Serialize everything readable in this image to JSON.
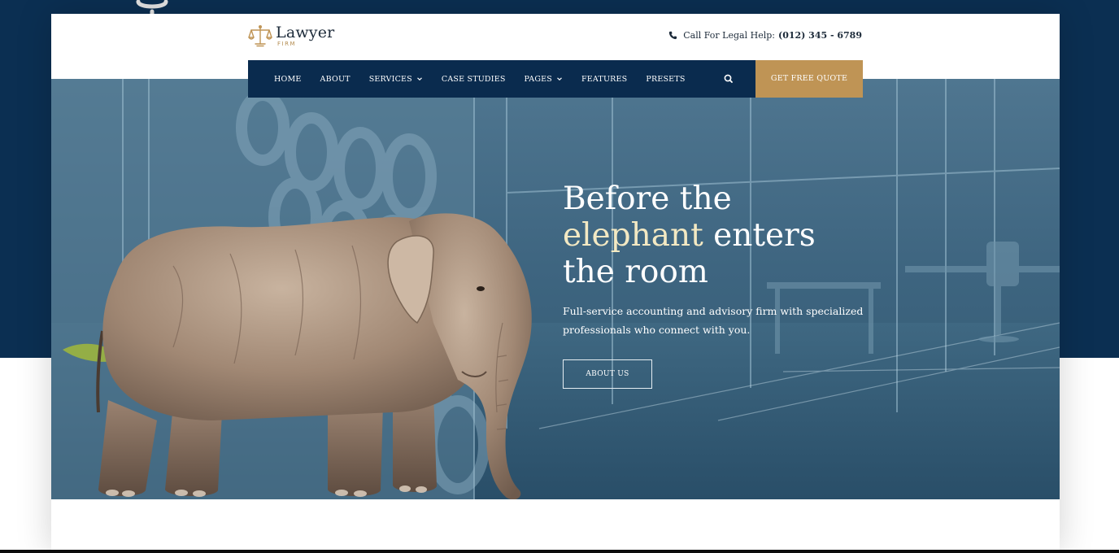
{
  "brand": {
    "name": "Lawyer",
    "tagline": "FIRM",
    "logo_icon": "scales-of-justice-icon",
    "accent_color": "#bf9455",
    "navy_color": "#0a2b4e"
  },
  "contact": {
    "icon": "phone-icon",
    "label": "Call For Legal Help:",
    "number": "(012) 345 - 6789"
  },
  "nav": {
    "items": [
      {
        "label": "HOME",
        "has_dropdown": false
      },
      {
        "label": "ABOUT",
        "has_dropdown": false
      },
      {
        "label": "SERVICES",
        "has_dropdown": true
      },
      {
        "label": "CASE STUDIES",
        "has_dropdown": false
      },
      {
        "label": "PAGES",
        "has_dropdown": true
      },
      {
        "label": "FEATURES",
        "has_dropdown": false
      },
      {
        "label": "PRESETS",
        "has_dropdown": false
      }
    ],
    "search_icon": "search-icon",
    "cta_label": "GET FREE QUOTE"
  },
  "hero": {
    "heading_line1": "Before the",
    "heading_accent": "elephant",
    "heading_line2_rest": " enters",
    "heading_line3": "the room",
    "subtext": "Full-service accounting and advisory firm with specialized professionals who connect with you.",
    "button_label": "ABOUT US",
    "image_subject": "elephant in glass office"
  }
}
